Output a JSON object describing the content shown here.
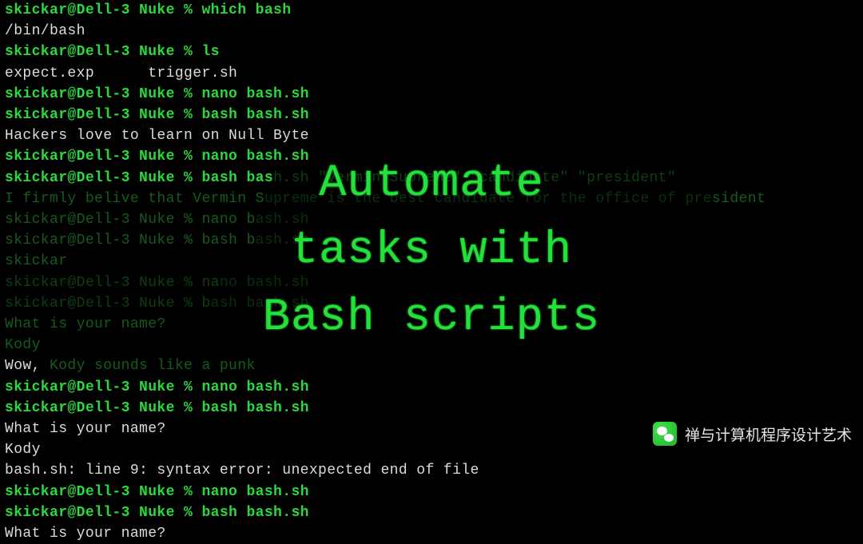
{
  "title_overlay": {
    "line1": "Automate",
    "line2": "tasks with",
    "line3": "Bash scripts"
  },
  "terminal": {
    "lines": [
      {
        "segments": [
          {
            "cls": "prompt",
            "text": "skickar@Dell-3 Nuke % which bash"
          }
        ]
      },
      {
        "segments": [
          {
            "cls": "out",
            "text": "/bin/bash"
          }
        ]
      },
      {
        "segments": [
          {
            "cls": "prompt",
            "text": "skickar@Dell-3 Nuke % ls"
          }
        ]
      },
      {
        "segments": [
          {
            "cls": "out",
            "text": "expect.exp      trigger.sh"
          }
        ]
      },
      {
        "segments": [
          {
            "cls": "prompt",
            "text": "skickar@Dell-3 Nuke % nano bash.sh"
          }
        ]
      },
      {
        "segments": [
          {
            "cls": "prompt",
            "text": "skickar@Dell-3 Nuke % bash bash.sh"
          }
        ]
      },
      {
        "segments": [
          {
            "cls": "out",
            "text": "Hackers love to learn on Null Byte"
          }
        ]
      },
      {
        "segments": [
          {
            "cls": "prompt",
            "text": "skickar@Dell-3 Nuke % nano bash.sh"
          }
        ]
      },
      {
        "segments": [
          {
            "cls": "prompt",
            "text": "skickar@Dell-3 Nuke % bash bas"
          },
          {
            "cls": "dim2",
            "text": "h.sh \"Vermin Supreme\" \"candidate\" \"president\""
          }
        ]
      },
      {
        "segments": [
          {
            "cls": "dim1",
            "text": "I firmly belive that Vermin S"
          },
          {
            "cls": "dim3",
            "text": "upreme is the best candidate for the office of pre"
          },
          {
            "cls": "dim1",
            "text": "sident"
          }
        ]
      },
      {
        "segments": [
          {
            "cls": "dim1",
            "text": "skickar@Dell-3 Nuke % nano b"
          },
          {
            "cls": "dim3",
            "text": "ash.sh"
          }
        ]
      },
      {
        "segments": [
          {
            "cls": "dim1",
            "text": "skickar@Dell-3 Nuke % bash b"
          },
          {
            "cls": "dim3",
            "text": "ash.sh"
          }
        ]
      },
      {
        "segments": [
          {
            "cls": "dim1",
            "text": "skickar"
          }
        ]
      },
      {
        "segments": [
          {
            "cls": "dim2",
            "text": "skickar@Dell-3 Nuke % na"
          },
          {
            "cls": "dim3",
            "text": "no bash.sh"
          }
        ]
      },
      {
        "segments": [
          {
            "cls": "dim2",
            "text": "skickar@Dell-3 Nuke % b"
          },
          {
            "cls": "dim3",
            "text": "ash bash.sh"
          }
        ]
      },
      {
        "segments": [
          {
            "cls": "dim1",
            "text": "What is your name?"
          }
        ]
      },
      {
        "segments": [
          {
            "cls": "dim1",
            "text": "Kody"
          }
        ]
      },
      {
        "segments": [
          {
            "cls": "out",
            "text": "Wow, "
          },
          {
            "cls": "dim1",
            "text": "Kody sounds like a punk"
          }
        ]
      },
      {
        "segments": [
          {
            "cls": "prompt",
            "text": "skickar@Dell-3 Nuke % nano bash.sh"
          }
        ]
      },
      {
        "segments": [
          {
            "cls": "prompt",
            "text": "skickar@Dell-3 Nuke % bash bash.sh"
          }
        ]
      },
      {
        "segments": [
          {
            "cls": "out",
            "text": "What is your name?"
          }
        ]
      },
      {
        "segments": [
          {
            "cls": "out",
            "text": "Kody"
          }
        ]
      },
      {
        "segments": [
          {
            "cls": "out",
            "text": "bash.sh: line 9: syntax error: unexpected end of file"
          }
        ]
      },
      {
        "segments": [
          {
            "cls": "prompt",
            "text": "skickar@Dell-3 Nuke % nano bash.sh"
          }
        ]
      },
      {
        "segments": [
          {
            "cls": "prompt",
            "text": "skickar@Dell-3 Nuke % bash bash.sh"
          }
        ]
      },
      {
        "segments": [
          {
            "cls": "out",
            "text": "What is your name?"
          }
        ]
      }
    ]
  },
  "watermark": {
    "icon": "wechat-icon",
    "text": "禅与计算机程序设计艺术"
  }
}
